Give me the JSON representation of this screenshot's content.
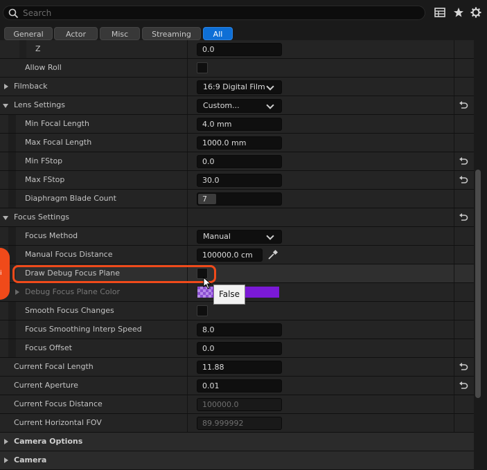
{
  "search": {
    "placeholder": "Search"
  },
  "toolbar": {
    "icons": [
      "table-view-icon",
      "favorites-star-icon",
      "settings-gear-icon"
    ]
  },
  "tabs": [
    {
      "label": "General",
      "active": false
    },
    {
      "label": "Actor",
      "active": false
    },
    {
      "label": "Misc",
      "active": false
    },
    {
      "label": "Streaming",
      "active": false
    },
    {
      "label": "All",
      "active": true
    }
  ],
  "properties": {
    "z": {
      "label": "Z",
      "value": "0.0"
    },
    "allow_roll": {
      "label": "Allow Roll",
      "checked": false
    },
    "filmback": {
      "label": "Filmback",
      "value": "16:9 Digital Film"
    },
    "lens_settings": {
      "label": "Lens Settings",
      "value": "Custom..."
    },
    "min_focal_length": {
      "label": "Min Focal Length",
      "value": "4.0 mm"
    },
    "max_focal_length": {
      "label": "Max Focal Length",
      "value": "1000.0 mm"
    },
    "min_fstop": {
      "label": "Min FStop",
      "value": "0.0"
    },
    "max_fstop": {
      "label": "Max FStop",
      "value": "30.0"
    },
    "diaphragm_blade_count": {
      "label": "Diaphragm Blade Count",
      "value": "7"
    },
    "focus_settings": {
      "label": "Focus Settings"
    },
    "focus_method": {
      "label": "Focus Method",
      "value": "Manual"
    },
    "manual_focus_distance": {
      "label": "Manual Focus Distance",
      "value": "100000.0 cm"
    },
    "draw_debug_focus_plane": {
      "label": "Draw Debug Focus Plane",
      "checked": false
    },
    "debug_focus_plane_color": {
      "label": "Debug Focus Plane Color",
      "color": "#7a19d6"
    },
    "smooth_focus_changes": {
      "label": "Smooth Focus Changes",
      "checked": false
    },
    "focus_smoothing_interp_speed": {
      "label": "Focus Smoothing Interp Speed",
      "value": "8.0"
    },
    "focus_offset": {
      "label": "Focus Offset",
      "value": "0.0"
    },
    "current_focal_length": {
      "label": "Current Focal Length",
      "value": "11.88"
    },
    "current_aperture": {
      "label": "Current Aperture",
      "value": "0.01"
    },
    "current_focus_distance": {
      "label": "Current Focus Distance",
      "value": "100000.0"
    },
    "current_horizontal_fov": {
      "label": "Current Horizontal FOV",
      "value": "89.999992"
    },
    "camera_options": {
      "label": "Camera Options"
    },
    "camera": {
      "label": "Camera"
    }
  },
  "tooltip": {
    "text": "False"
  },
  "colors": {
    "accent": "#0e6fd6",
    "annotation": "#f04a1a",
    "debug_plane": "#7a19d6"
  }
}
